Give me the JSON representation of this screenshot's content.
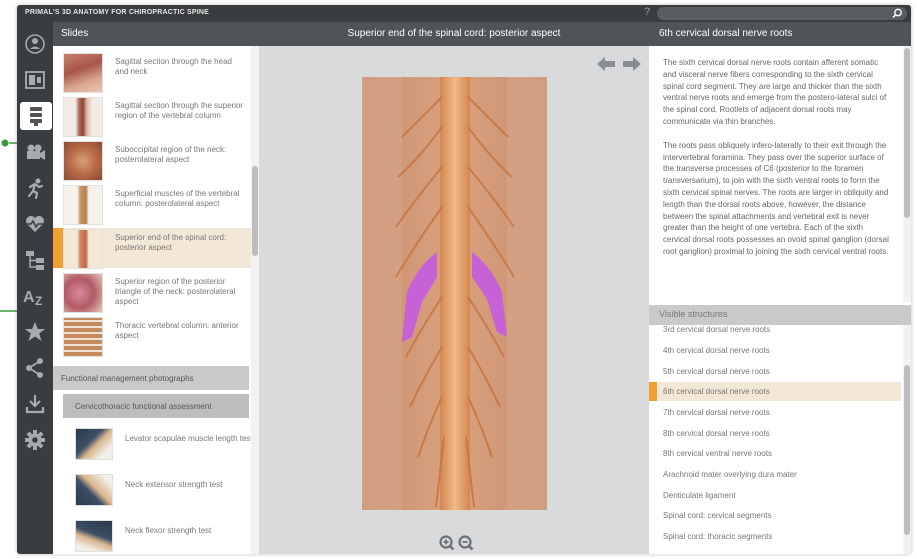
{
  "app": {
    "title": "PRIMAL'S 3D ANATOMY FOR CHIROPRACTIC SPINE",
    "help": "?"
  },
  "colors": {
    "accent": "#f0a030",
    "header": "#505458",
    "sidebar": "#3a3d40",
    "structure_highlight": "#c55be0",
    "callout": "#3c9a3c"
  },
  "iconbar": [
    "3d-model-icon",
    "slides-icon",
    "spine-icon",
    "video-icon",
    "running-man-icon",
    "heartbeat-icon",
    "hierarchy-icon",
    "az-index-icon",
    "star-icon",
    "share-icon",
    "download-icon",
    "settings-icon"
  ],
  "slides": {
    "header": "Slides",
    "items": [
      {
        "label": "Sagittal section through the head and neck"
      },
      {
        "label": "Sagittal section through the superior region of the vertebral column"
      },
      {
        "label": "Suboccipital region of the neck: posterolateral aspect"
      },
      {
        "label": "Superficial muscles of the vertebral column: posterolateral aspect"
      },
      {
        "label": "Superior end of the spinal cord: posterior aspect",
        "selected": true
      },
      {
        "label": "Superior region of the posterior triangle of the neck: posterolateral aspect"
      },
      {
        "label": "Thoracic vertebral column: anterior aspect"
      }
    ],
    "section": "Functional management photographs",
    "subsection": "Cervicothoracic functional assessment",
    "tests": [
      {
        "label": "Levator scapulae muscle length test"
      },
      {
        "label": "Neck extensor strength test"
      },
      {
        "label": "Neck flexor strength test"
      }
    ]
  },
  "center": {
    "title": "Superior end of the spinal cord: posterior aspect"
  },
  "right": {
    "title": "6th cervical dorsal nerve roots",
    "paragraphs": [
      "The sixth cervical dorsal nerve roots contain afferent somatic and visceral nerve fibers corresponding to the sixth cervical spinal cord segment. They are large and thicker than the sixth ventral nerve roots and emerge from the postero-lateral sulci of the spinal cord. Rootlets of adjacent dorsal roots may communicate via thin branches.",
      "The roots pass obliquely infero-laterally to their exit through the intervertebral foramina. They pass over the superior surface of the transverse processes of C6 (posterior to the foramen transversarium), to join with the sixth ventral roots to form the sixth cervical spinal nerves. The roots are larger in obliquity and length than the dorsal roots above, however, the distance between the spinal attachments and vertebral exit is never greater than the height of one vertebra. Each of the sixth cervical dorsal roots possesses an ovoid spinal ganglion (dorsal root ganglion) proximal to joining the sixth cervical ventral roots."
    ],
    "visible_header": "Visible structures",
    "structures": [
      {
        "label": "3rd cervical dorsal nerve roots"
      },
      {
        "label": "4th cervical dorsal nerve roots"
      },
      {
        "label": "5th cervical dorsal nerve roots"
      },
      {
        "label": "6th cervical dorsal nerve roots",
        "selected": true
      },
      {
        "label": "7th cervical dorsal nerve roots"
      },
      {
        "label": "8th cervical dorsal nerve roots"
      },
      {
        "label": "8th cervical ventral nerve roots"
      },
      {
        "label": "Arachnoid mater overlying dura mater"
      },
      {
        "label": "Denticulate ligament"
      },
      {
        "label": "Spinal cord: cervical segments"
      },
      {
        "label": "Spinal cord: thoracic segments"
      }
    ]
  }
}
